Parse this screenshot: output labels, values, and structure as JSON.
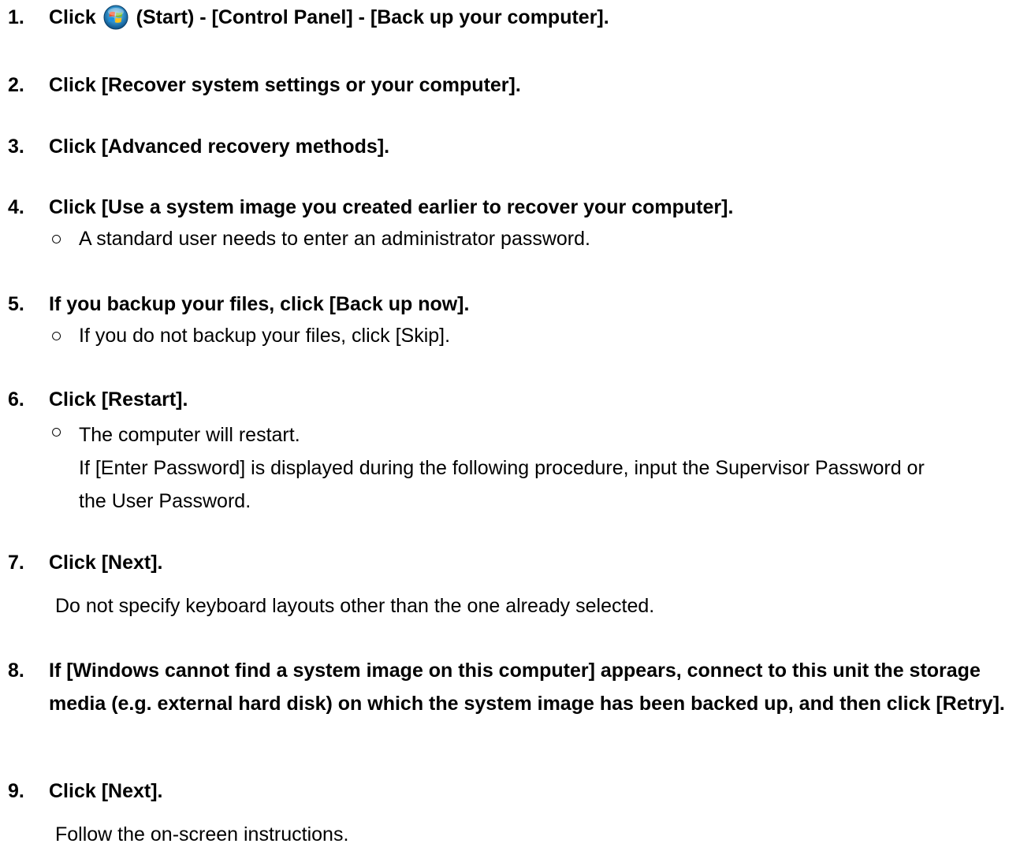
{
  "steps": [
    {
      "num": "1.",
      "pre": "Click",
      "icon": "windows-start-orb-icon",
      "post": "(Start) - [Control Panel] - [Back up your computer]."
    },
    {
      "num": "2.",
      "text": "Click [Recover system settings or your computer]."
    },
    {
      "num": "3.",
      "text": "Click [Advanced recovery methods]."
    },
    {
      "num": "4.",
      "text": "Click [Use a system image you created earlier to recover your computer].",
      "sub": "A standard user needs to enter an administrator password."
    },
    {
      "num": "5.",
      "text": "If you backup your files, click [Back up now].",
      "sub": "If you do not backup your files, click [Skip]."
    },
    {
      "num": "6.",
      "text": "Click [Restart].",
      "sub": "The computer will restart.",
      "sub_more": "If [Enter Password] is displayed during the following procedure, input the Supervisor Password or the User Password."
    },
    {
      "num": "7.",
      "text": "Click [Next].",
      "note": "Do not specify keyboard layouts other than the one already selected."
    },
    {
      "num": "8.",
      "text": "If [Windows cannot find a system image on this computer] appears, connect to this unit the storage media (e.g. external hard disk) on which the system image has been backed up, and then click [Retry]."
    },
    {
      "num": "9.",
      "text": "Click [Next].",
      "note": "Follow the on-screen instructions."
    }
  ],
  "bullet": "○"
}
